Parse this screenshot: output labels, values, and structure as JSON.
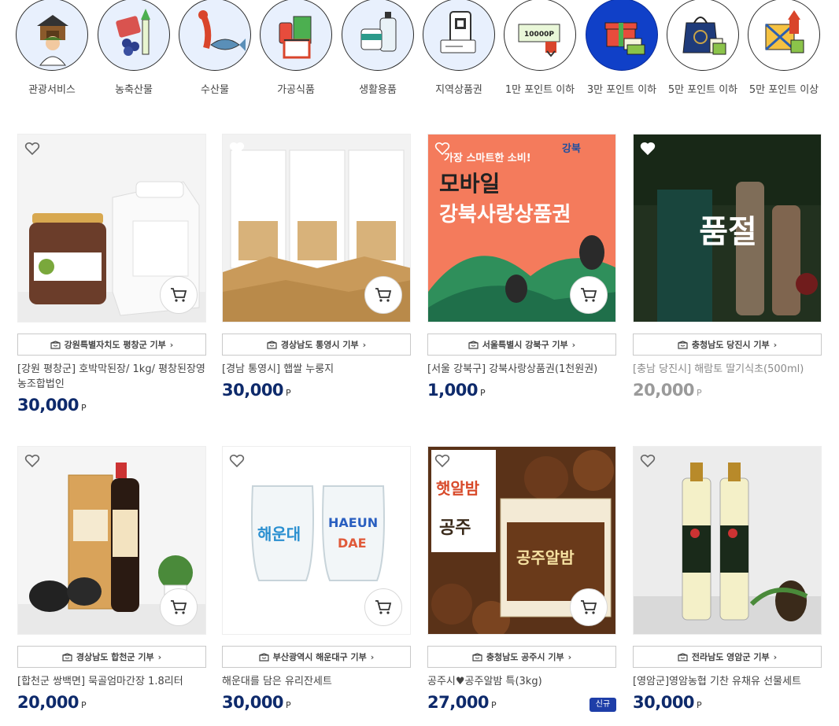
{
  "categories": [
    {
      "label": "관광서비스",
      "icon": "tourism-icon",
      "style": "light"
    },
    {
      "label": "농축산물",
      "icon": "agriculture-icon",
      "style": "light"
    },
    {
      "label": "수산물",
      "icon": "seafood-icon",
      "style": "light"
    },
    {
      "label": "가공식품",
      "icon": "processed-food-icon",
      "style": "light"
    },
    {
      "label": "생활용품",
      "icon": "household-icon",
      "style": "light"
    },
    {
      "label": "지역상품권",
      "icon": "voucher-icon",
      "style": "light"
    },
    {
      "label": "1만 포인트 이하",
      "icon": "points-10000-icon",
      "badge": "10000P",
      "style": "white"
    },
    {
      "label": "3만 포인트 이하",
      "icon": "gift-icon",
      "style": "active"
    },
    {
      "label": "5만 포인트 이하",
      "icon": "shopping-bag-icon",
      "style": "white"
    },
    {
      "label": "5만 포인트 이상",
      "icon": "gift-box-up-icon",
      "style": "white"
    }
  ],
  "products": [
    {
      "donor": "강원특별자치도 평창군 기부",
      "name": "[강원 평창군] 호박막된장/ 1kg/ 평창된장영농조합법인",
      "price": "30,000",
      "unit": "P",
      "soldout": false,
      "new": false
    },
    {
      "donor": "경상남도 통영시 기부",
      "name": "[경남 통영시] 햅쌀 누룽지",
      "price": "30,000",
      "unit": "P",
      "soldout": false,
      "new": false
    },
    {
      "donor": "서울특별시 강북구 기부",
      "name": "[서울 강북구] 강북사랑상품권(1천원권)",
      "price": "1,000",
      "unit": "P",
      "soldout": false,
      "new": false,
      "image_text": {
        "line1": "가장 스마트한 소비!",
        "line2": "모바일",
        "line3": "강북사랑상품권",
        "logo": "강북"
      }
    },
    {
      "donor": "충청남도 당진시 기부",
      "name": "[충남 당진시] 해람토 딸기식초(500ml)",
      "price": "20,000",
      "unit": "P",
      "soldout": true,
      "soldout_label": "품절",
      "new": false
    },
    {
      "donor": "경상남도 합천군 기부",
      "name": "[합천군 쌍백면] 묵골엄마간장 1.8리터",
      "price": "20,000",
      "unit": "P",
      "soldout": false,
      "new": false
    },
    {
      "donor": "부산광역시 해운대구 기부",
      "name": "해운대를 담은 유리잔세트",
      "price": "30,000",
      "unit": "P",
      "soldout": false,
      "new": false,
      "image_text": {
        "cup1": "해운대",
        "cup2a": "HAEUN",
        "cup2b": "DAE"
      }
    },
    {
      "donor": "충청남도 공주시 기부",
      "name": "공주시♥공주알밤 특(3kg)",
      "price": "27,000",
      "unit": "P",
      "soldout": false,
      "new": true,
      "new_label": "신규",
      "image_text": {
        "tag1": "햇알밤",
        "tag2": "공주",
        "box": "공주알밤"
      }
    },
    {
      "donor": "전라남도 영암군 기부",
      "name": "[영암군]영암농협 기찬 유채유 선물세트",
      "price": "30,000",
      "unit": "P",
      "soldout": false,
      "new": false
    }
  ]
}
